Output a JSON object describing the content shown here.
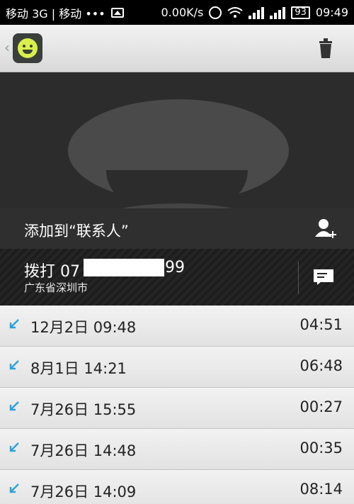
{
  "status_bar": {
    "carrier": "移动 3G | 移动 •••",
    "speed": "0.00K/s",
    "battery": "93",
    "time": "09:49"
  },
  "header": {
    "back_symbol": "‹",
    "app_icon": "smiley-app-icon",
    "delete_icon": "trash-icon"
  },
  "contact": {
    "avatar_icon": "default-avatar-icon",
    "add_label": "添加到“联系人”",
    "add_icon": "add-person-icon"
  },
  "dial": {
    "prefix": "拨打 07",
    "suffix": "99",
    "location": "广东省深圳市",
    "sms_icon": "message-icon"
  },
  "calls": [
    {
      "datetime": "12月2日 09:48",
      "duration": "04:51",
      "type": "incoming"
    },
    {
      "datetime": "8月1日 14:21",
      "duration": "06:48",
      "type": "incoming"
    },
    {
      "datetime": "7月26日 15:55",
      "duration": "00:27",
      "type": "incoming"
    },
    {
      "datetime": "7月26日 14:48",
      "duration": "00:35",
      "type": "incoming"
    },
    {
      "datetime": "7月26日 14:09",
      "duration": "08:14",
      "type": "incoming"
    }
  ],
  "colors": {
    "incoming_arrow": "#2aa3d9"
  }
}
